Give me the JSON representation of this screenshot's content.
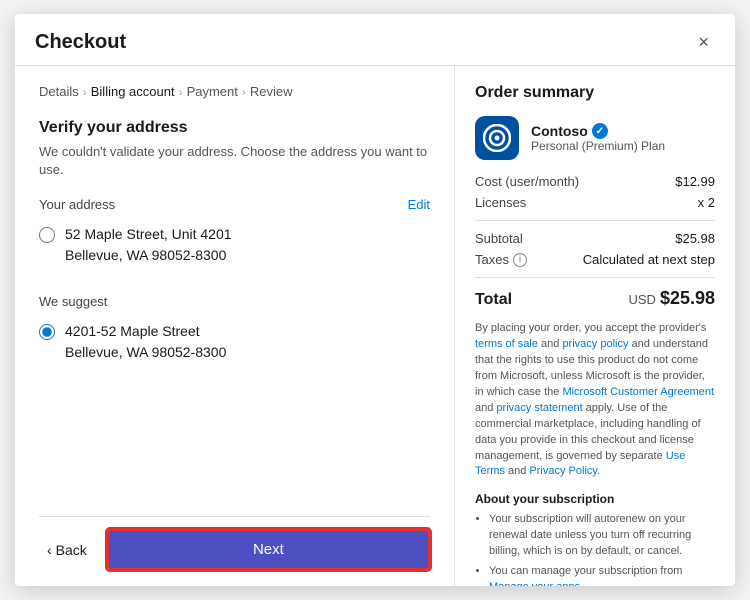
{
  "modal": {
    "title": "Checkout",
    "close_label": "×"
  },
  "breadcrumb": {
    "items": [
      {
        "label": "Details",
        "active": false
      },
      {
        "label": "Billing account",
        "active": true
      },
      {
        "label": "Payment",
        "active": false
      },
      {
        "label": "Review",
        "active": false
      }
    ]
  },
  "left": {
    "section_title": "Verify your address",
    "section_desc": "We couldn't validate your address. Choose the address you want to use.",
    "your_address_label": "Your address",
    "edit_label": "Edit",
    "your_address_line1": "52 Maple Street, Unit 4201",
    "your_address_line2": "Bellevue, WA 98052-8300",
    "we_suggest_label": "We suggest",
    "suggested_address_line1": "4201-52 Maple Street",
    "suggested_address_line2": "Bellevue, WA 98052-8300",
    "back_label": "Back",
    "next_label": "Next"
  },
  "right": {
    "order_summary_title": "Order summary",
    "product_name": "Contoso",
    "product_plan": "Personal (Premium) Plan",
    "cost_label": "Cost  (user/month)",
    "cost_value": "$12.99",
    "licenses_label": "Licenses",
    "licenses_value": "x 2",
    "subtotal_label": "Subtotal",
    "subtotal_value": "$25.98",
    "taxes_label": "Taxes",
    "taxes_value": "Calculated at next step",
    "total_label": "Total",
    "total_currency": "USD",
    "total_value": "$25.98",
    "legal_text": "By placing your order, you accept the provider's terms of sale and privacy policy and understand that the rights to use this product do not come from Microsoft, unless Microsoft is the provider, in which case the Microsoft Customer Agreement and privacy statement apply. Use of the commercial marketplace, including handling of data you provide in this checkout and license management, is governed by separate Use Terms and Privacy Policy.",
    "about_title": "About your subscription",
    "about_items": [
      "Your subscription will autorenew on your renewal date unless you turn off recurring billing, which is on by default, or cancel.",
      "You can manage your subscription from Manage your apps."
    ]
  }
}
